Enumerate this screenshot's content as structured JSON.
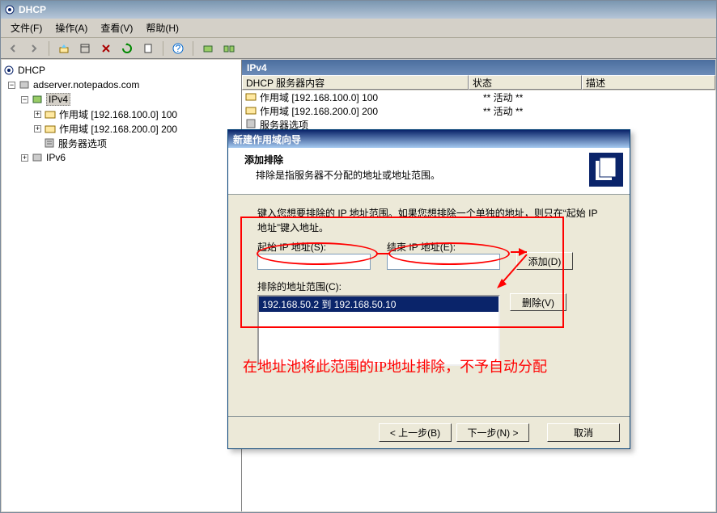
{
  "window": {
    "title": "DHCP"
  },
  "menu": {
    "file": "文件(F)",
    "action": "操作(A)",
    "view": "查看(V)",
    "help": "帮助(H)"
  },
  "tree": {
    "root": "DHCP",
    "server": "adserver.notepados.com",
    "ipv4": "IPv4",
    "scope100": "作用域 [192.168.100.0] 100",
    "scope200": "作用域 [192.168.200.0] 200",
    "serverOptions": "服务器选项",
    "ipv6": "IPv6"
  },
  "list": {
    "header": "IPv4",
    "cols": {
      "name": "DHCP 服务器内容",
      "status": "状态",
      "desc": "描述"
    },
    "rows": [
      {
        "name": "作用域 [192.168.100.0] 100",
        "status": "** 活动 **",
        "desc": ""
      },
      {
        "name": "作用域 [192.168.200.0] 200",
        "status": "** 活动 **",
        "desc": ""
      },
      {
        "name": "服务器选项",
        "status": "",
        "desc": ""
      }
    ]
  },
  "wizard": {
    "title": "新建作用域向导",
    "header": {
      "title": "添加排除",
      "sub": "排除是指服务器不分配的地址或地址范围。"
    },
    "instruction": "键入您想要排除的 IP 地址范围。如果您想排除一个单独的地址，则只在“起始 IP 地址”键入地址。",
    "labels": {
      "startIp": "起始 IP 地址(S):",
      "endIp": "结束 IP 地址(E):",
      "excluded": "排除的地址范围(C):"
    },
    "buttons": {
      "add": "添加(D)",
      "remove": "删除(V)",
      "back": "< 上一步(B)",
      "next": "下一步(N) >",
      "cancel": "取消"
    },
    "startIpValue": "",
    "endIpValue": "",
    "exclusions": [
      "192.168.50.2 到 192.168.50.10"
    ]
  },
  "annotation": "在地址池将此范围的IP地址排除，不予自动分配"
}
